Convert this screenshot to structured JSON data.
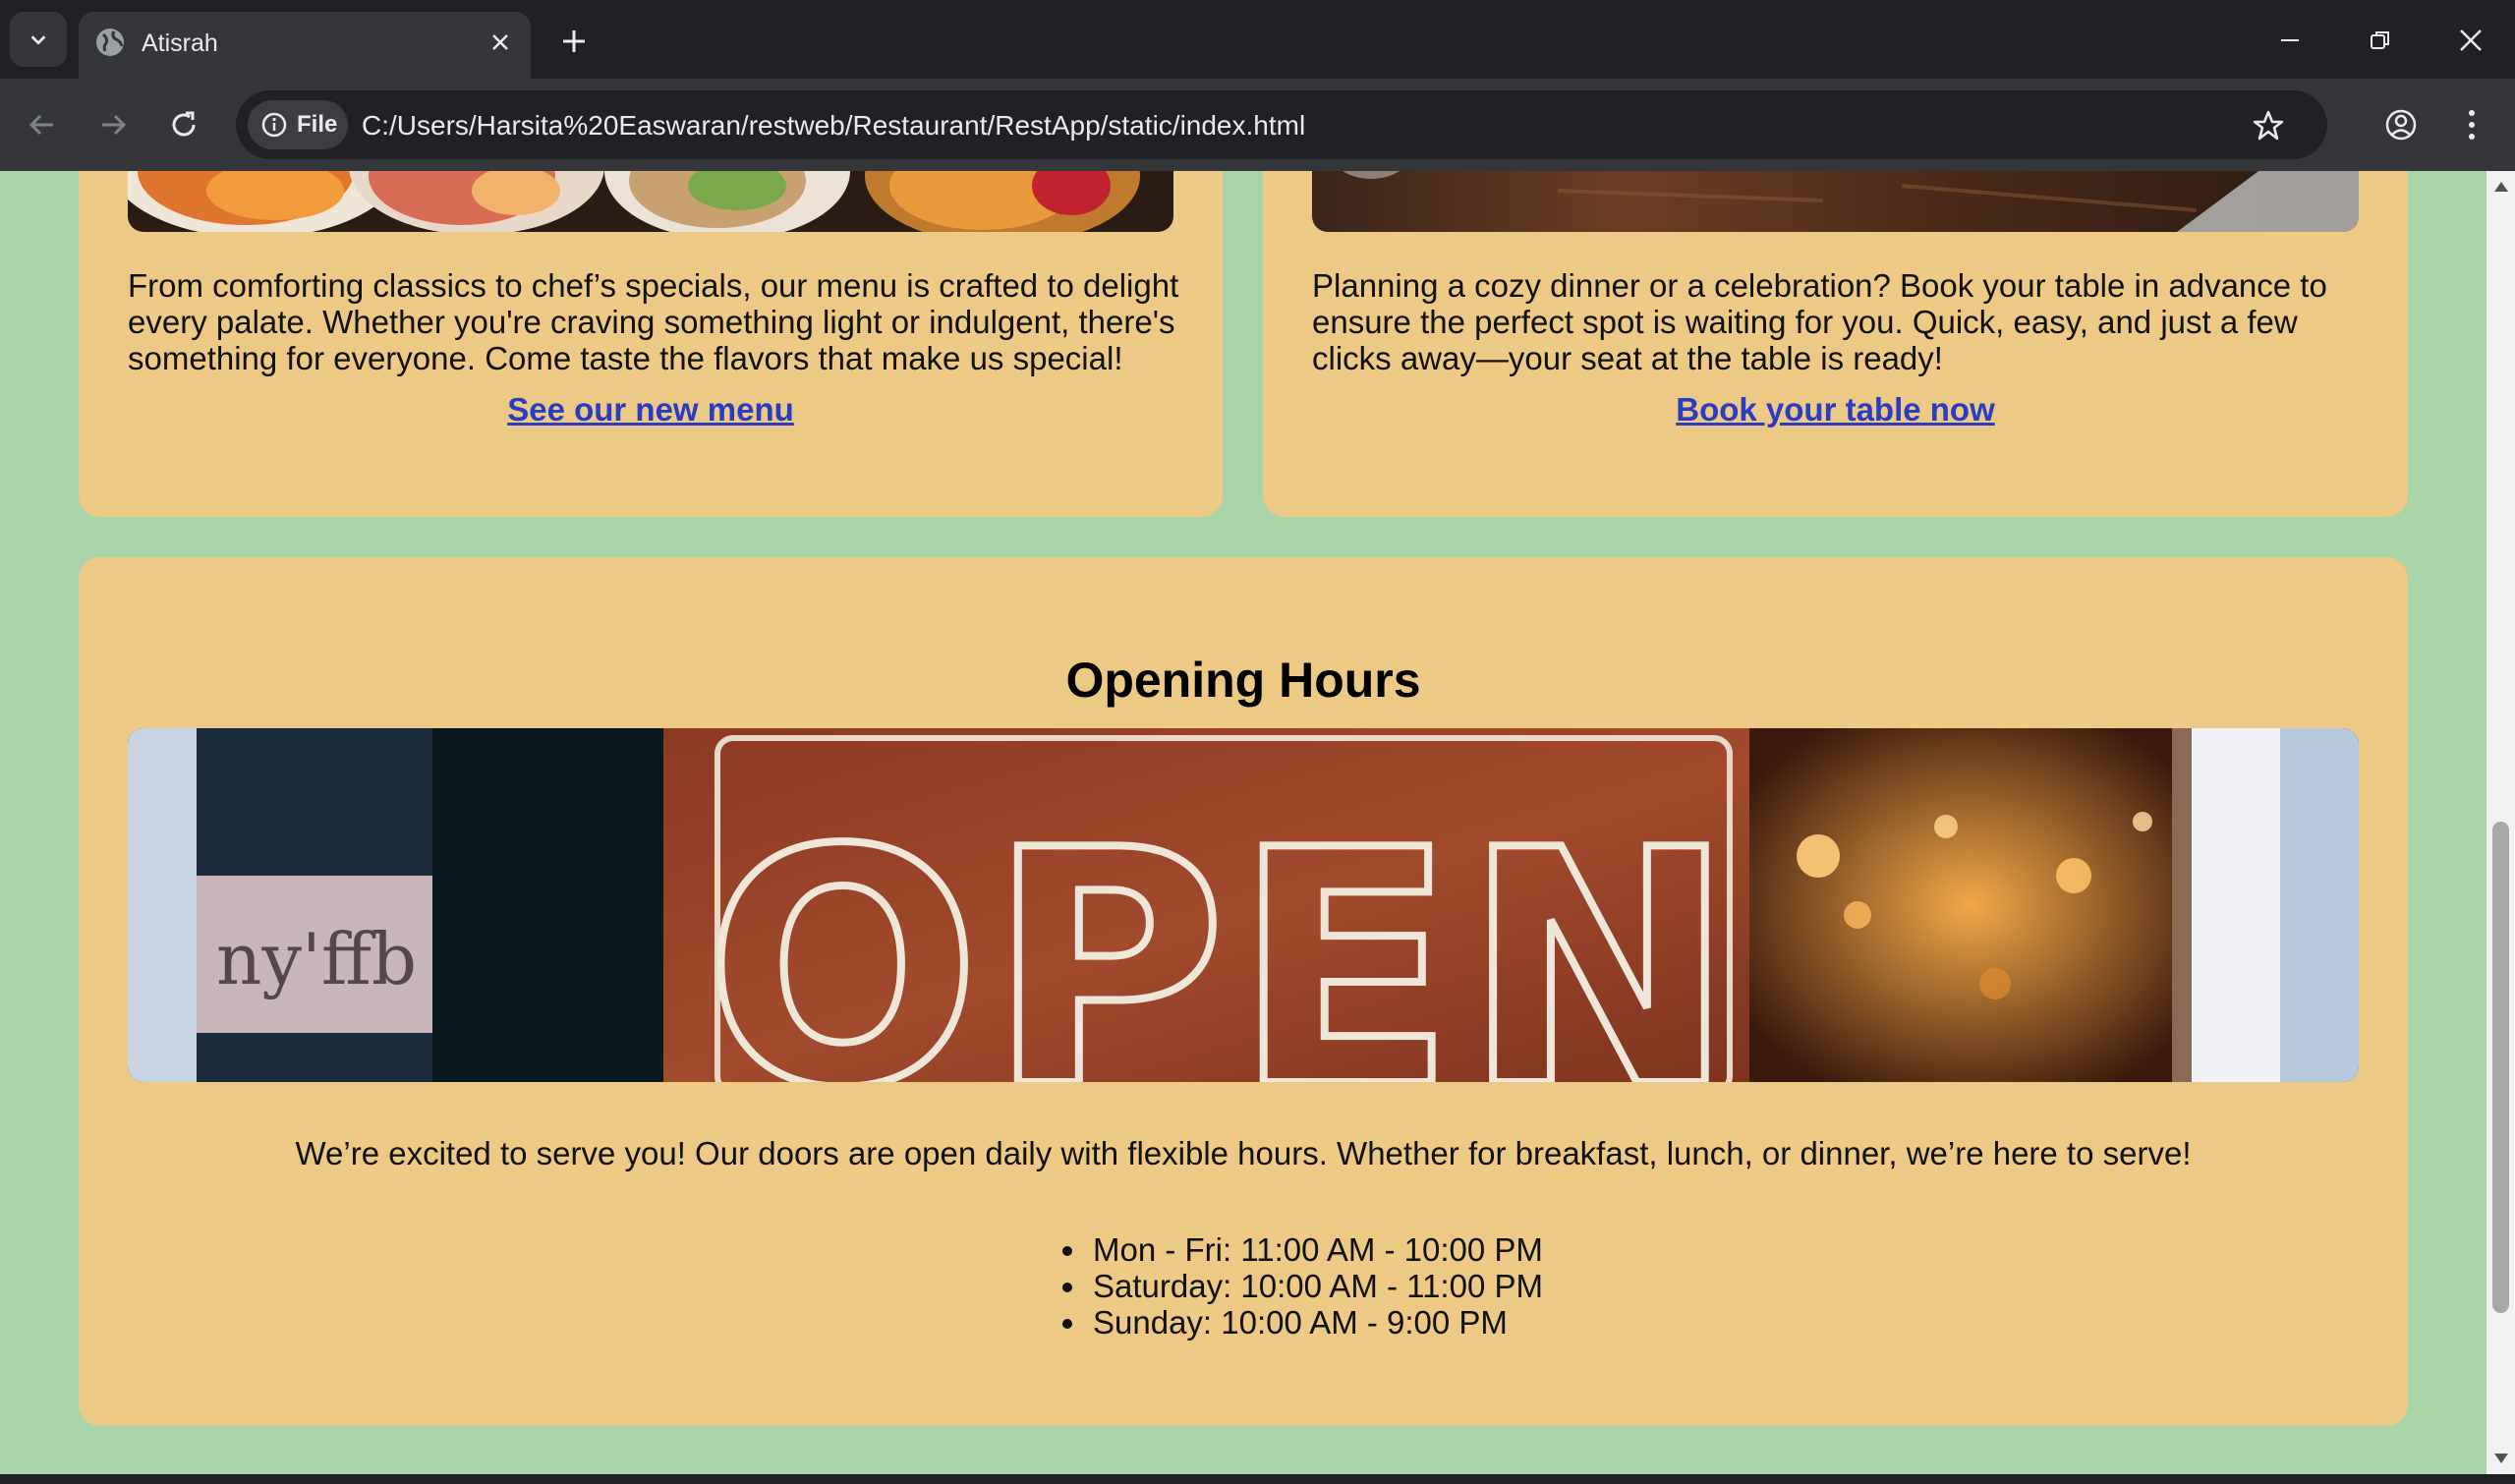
{
  "browser": {
    "tab_title": "Atisrah",
    "site_chip_label": "File",
    "url": "C:/Users/Harsita%20Easwaran/restweb/Restaurant/RestApp/static/index.html"
  },
  "menu_card": {
    "text": "From comforting classics to chef’s specials, our menu is crafted to delight every palate. Whether you're craving something light or indulgent, there's something for everyone. Come taste the flavors that make us special!",
    "link": "See our new menu"
  },
  "booking_card": {
    "text": "Planning a cozy dinner or a celebration? Book your table in advance to ensure the perfect spot is waiting for you. Quick, easy, and just a few clicks away—your seat at the table is ready!",
    "link": "Book your table now"
  },
  "opening_hours": {
    "title": "Opening Hours",
    "sign_text": "OPEN",
    "intro": "We’re excited to serve you! Our doors are open daily with flexible hours. Whether for breakfast, lunch, or dinner, we’re here to serve!",
    "hours": [
      "Mon - Fri: 11:00 AM - 10:00 PM",
      "Saturday: 10:00 AM - 11:00 PM",
      "Sunday: 10:00 AM - 9:00 PM"
    ]
  },
  "colors": {
    "page_background": "#a9d4aa",
    "card_background": "#ecc985",
    "link": "#2a3bc4"
  }
}
